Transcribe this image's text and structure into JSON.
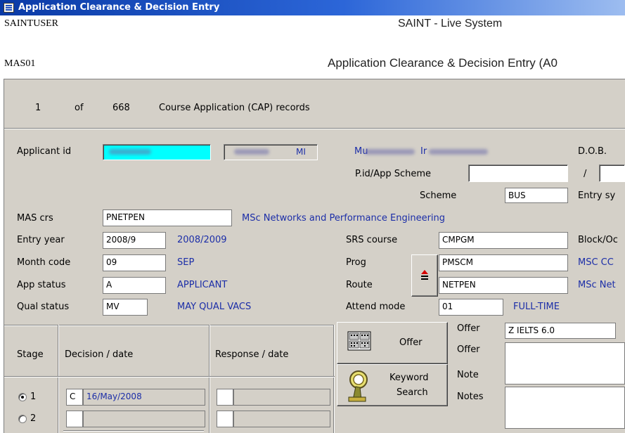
{
  "window": {
    "title": "Application Clearance & Decision Entry"
  },
  "header": {
    "user": "SAINTUSER",
    "system": "SAINT - Live System",
    "screen_code": "MAS01",
    "screen_title": "Application Clearance & Decision Entry (A0"
  },
  "records": {
    "current": "1",
    "of_label": "of",
    "total": "668",
    "description": "Course Application (CAP) records"
  },
  "applicant": {
    "id_label": "Applicant id",
    "name_initial": "MI",
    "name_part1": "Mu",
    "name_part2": "Ir",
    "dob_label": "D.O.B.",
    "pid_label": "P.id/App Scheme",
    "pid_value": "",
    "slash": "/",
    "scheme_label": "Scheme",
    "scheme_value": "BUS",
    "entry_sys_label": "Entry sy"
  },
  "mas_crs": {
    "label": "MAS crs",
    "value": "PNETPEN",
    "desc": "MSc Networks and Performance Engineering"
  },
  "entry_year": {
    "label": "Entry year",
    "value": "2008/9",
    "desc": "2008/2009"
  },
  "month_code": {
    "label": "Month code",
    "value": "09",
    "desc": "SEP"
  },
  "app_status": {
    "label": "App status",
    "value": "A",
    "desc": "APPLICANT"
  },
  "qual_status": {
    "label": "Qual status",
    "value": "MV",
    "desc": "MAY QUAL VACS"
  },
  "srs_course": {
    "label": "SRS course",
    "value": "CMPGM",
    "right_label": "Block/Oc"
  },
  "prog": {
    "label": "Prog",
    "value": "PMSCM",
    "right_desc": "MSC CC"
  },
  "route": {
    "label": "Route",
    "value": "NETPEN",
    "right_desc": "MSc Net"
  },
  "attend_mode": {
    "label": "Attend mode",
    "value": "01",
    "desc": "FULL-TIME"
  },
  "buttons": {
    "offer": "Offer",
    "keyword_line1": "Keyword",
    "keyword_line2": "Search"
  },
  "offer_panel": {
    "offer_label1": "Offer",
    "offer_value": "Z IELTS 6.0",
    "offer_label2": "Offer",
    "note_label": "Note",
    "notes_label": "Notes"
  },
  "grid": {
    "stage_header": "Stage",
    "decision_header": "Decision / date",
    "response_header": "Response / date",
    "rows": [
      {
        "stage": "1",
        "decision_code": "C",
        "decision_date": "16/May/2008",
        "selected": true
      },
      {
        "stage": "2",
        "decision_code": "",
        "decision_date": "",
        "selected": false
      }
    ]
  }
}
